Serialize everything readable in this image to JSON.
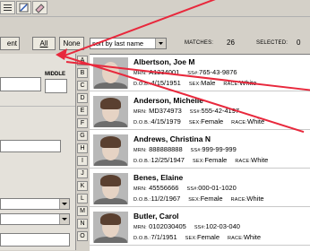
{
  "toolbar": {
    "icons": [
      "list-icon",
      "edit-icon",
      "eraser-icon"
    ]
  },
  "controls": {
    "ent_label": "ent",
    "all_label": "All",
    "none_label": "None",
    "sort_value": "sort by last name",
    "matches_label": "MATCHES:",
    "matches_value": "26",
    "selected_label": "SELECTED:",
    "selected_value": "0"
  },
  "left_panel": {
    "middle_label": "MIDDLE"
  },
  "alpha_index": [
    "A",
    "B",
    "C",
    "D",
    "E",
    "F",
    "G",
    "H",
    "I",
    "J",
    "K",
    "L",
    "M",
    "N",
    "O"
  ],
  "labels": {
    "mrn": "MRN:",
    "ssn": "SS#:",
    "dob": "D.O.B.:",
    "sex": "SEX:",
    "race": "RACE:"
  },
  "patients": [
    {
      "name": "Albertson, Joe M",
      "mrn": "A1234001",
      "ssn": "765-43-9876",
      "dob": "4/15/1951",
      "sex": "Male",
      "race": "White",
      "photo": "man-portrait"
    },
    {
      "name": "Anderson, Michelle",
      "mrn": "MD374973",
      "ssn": "555-42-4197",
      "dob": "4/15/1979",
      "sex": "Female",
      "race": "White",
      "photo": "woman-portrait"
    },
    {
      "name": "Andrews, Christina N",
      "mrn": "888888888",
      "ssn": "999-99-999",
      "dob": "12/25/1947",
      "sex": "Female",
      "race": "White",
      "photo": "woman-portrait"
    },
    {
      "name": "Benes, Elaine",
      "mrn": "45556666",
      "ssn": "000-01-1020",
      "dob": "11/2/1967",
      "sex": "Female",
      "race": "White",
      "photo": "woman-portrait"
    },
    {
      "name": "Butler, Carol",
      "mrn": "0102030405",
      "ssn": "102-03-040",
      "dob": "7/1/1951",
      "sex": "Female",
      "race": "White",
      "photo": "woman-portrait"
    }
  ],
  "colors": {
    "accent_arrow": "#e8283c",
    "panel_bg": "#d4d0c8"
  }
}
